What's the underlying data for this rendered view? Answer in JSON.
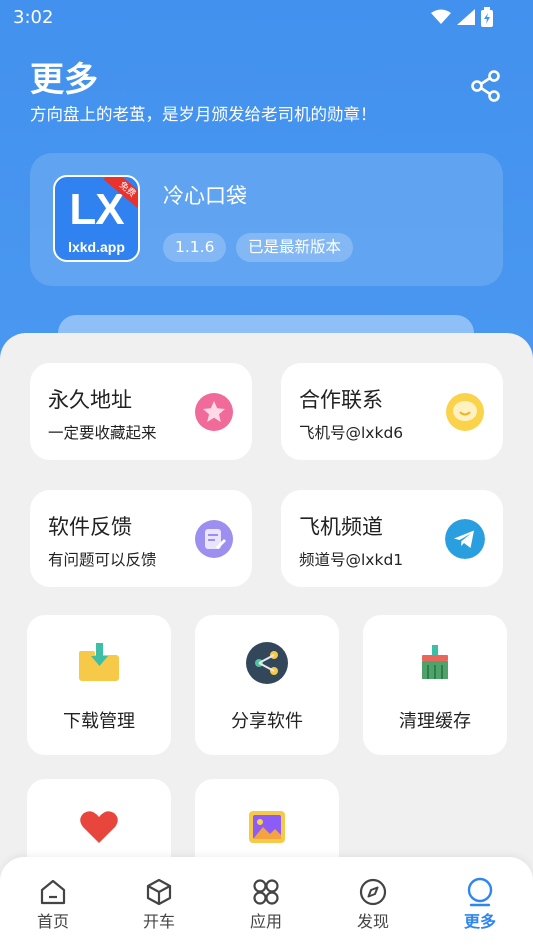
{
  "status_bar": {
    "time": "3:02"
  },
  "header": {
    "title": "更多",
    "subtitle": "方向盘上的老茧，是岁月颁发给老司机的勋章！"
  },
  "app_card": {
    "logo_text": "LX",
    "logo_domain": "lxkd.app",
    "logo_ribbon": "免费",
    "name": "冷心口袋",
    "version": "1.1.6",
    "status": "已是最新版本"
  },
  "info_cards": [
    {
      "title": "永久地址",
      "subtitle": "一定要收藏起来",
      "icon": "star-icon",
      "color": "#f06b9a"
    },
    {
      "title": "合作联系",
      "subtitle": "飞机号@lxkd6",
      "icon": "chat-bubble-icon",
      "color": "#fbd34a"
    },
    {
      "title": "软件反馈",
      "subtitle": "有问题可以反馈",
      "icon": "feedback-icon",
      "color": "#9d8ff0"
    },
    {
      "title": "飞机频道",
      "subtitle": "频道号@lxkd1",
      "icon": "telegram-icon",
      "color": "#2a9fe0"
    }
  ],
  "tiles": [
    {
      "label": "下载管理",
      "icon": "download-folder-icon"
    },
    {
      "label": "分享软件",
      "icon": "share-circle-icon"
    },
    {
      "label": "清理缓存",
      "icon": "broom-icon"
    },
    {
      "label": "",
      "icon": "heart-icon"
    },
    {
      "label": "",
      "icon": "picture-icon"
    }
  ],
  "nav": [
    {
      "label": "首页",
      "icon": "home-icon"
    },
    {
      "label": "开车",
      "icon": "cube-icon"
    },
    {
      "label": "应用",
      "icon": "apps-grid-icon"
    },
    {
      "label": "发现",
      "icon": "compass-icon"
    },
    {
      "label": "更多",
      "icon": "more-user-icon",
      "active": true
    }
  ],
  "colors": {
    "primary": "#4291ee",
    "active_nav": "#2f86f0"
  }
}
